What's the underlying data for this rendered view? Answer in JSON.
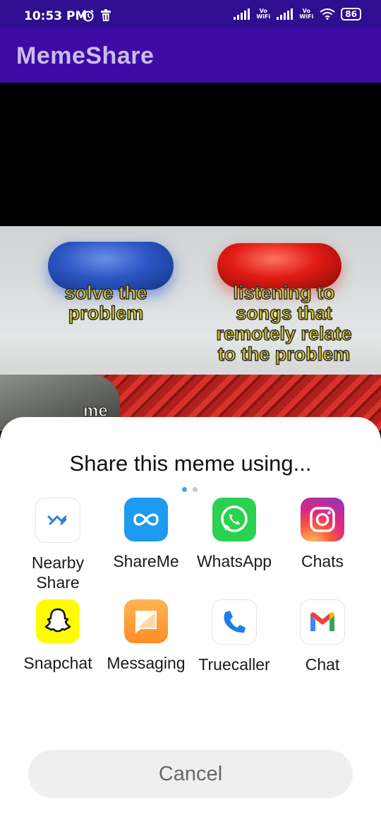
{
  "status_bar": {
    "time": "10:53 PM",
    "sim1": "Vo WiFi",
    "sim2": "Vo WiFi",
    "battery": "86"
  },
  "app_bar": {
    "title": "MemeShare"
  },
  "meme": {
    "caption_left": "solve the problem",
    "caption_right": "listening to songs that remotely relate to the problem",
    "caption_bottom": "me"
  },
  "share_sheet": {
    "title": "Share this meme using...",
    "apps": [
      {
        "label": "Nearby Share",
        "icon": "nearby-share-icon"
      },
      {
        "label": "ShareMe",
        "icon": "shareme-icon"
      },
      {
        "label": "WhatsApp",
        "icon": "whatsapp-icon"
      },
      {
        "label": "Chats",
        "icon": "instagram-icon"
      },
      {
        "label": "Snapchat",
        "icon": "snapchat-icon"
      },
      {
        "label": "Messaging",
        "icon": "messaging-icon"
      },
      {
        "label": "Truecaller",
        "icon": "truecaller-icon"
      },
      {
        "label": "Chat",
        "icon": "gmail-icon"
      }
    ],
    "page_indicator": {
      "pages": 2,
      "current": 1
    },
    "cancel_label": "Cancel"
  },
  "colors": {
    "status_bar": "#2f0e8f",
    "app_bar": "#3d0aa6",
    "accent": "#4aa2e5"
  }
}
